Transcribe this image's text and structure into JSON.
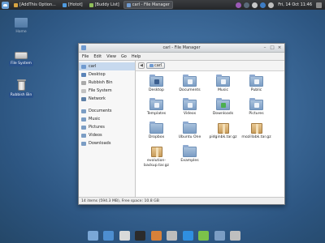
{
  "panel": {
    "tasks": [
      {
        "label": "[AddThis Option...",
        "color": "#d9a441",
        "active": false
      },
      {
        "label": "[Hotot]",
        "color": "#4f9be0",
        "active": false
      },
      {
        "label": "[Buddy List]",
        "color": "#8fbf5a",
        "active": false
      },
      {
        "label": "carl - File Manager",
        "color": "#6f9ad0",
        "active": true
      }
    ],
    "clock": "Fri, 14 Oct  11:46",
    "tray_colors": [
      "#9b59b6",
      "#5a6a7a",
      "#c7c7c7",
      "#3d7cc4",
      "#bdbdbd"
    ]
  },
  "desktop": {
    "home_label": "Home",
    "filesystem_label": "File System",
    "trash_label": "Rubbish Bin"
  },
  "window": {
    "title": "carl - File Manager",
    "menu": [
      "File",
      "Edit",
      "View",
      "Go",
      "Help"
    ],
    "sidebar": [
      {
        "label": "carl",
        "icon": "home-icon",
        "color": "#6f9ad0",
        "selected": true
      },
      {
        "label": "Desktop",
        "icon": "desktop-icon",
        "color": "#5b84b8"
      },
      {
        "label": "Rubbish Bin",
        "icon": "trash-icon",
        "color": "#a9a9a9"
      },
      {
        "label": "File System",
        "icon": "drive-icon",
        "color": "#c2c2c2"
      },
      {
        "label": "Network",
        "icon": "network-icon",
        "color": "#5d7fa6"
      },
      {
        "label": "Documents",
        "icon": "folder-icon",
        "color": "#7b9dc4"
      },
      {
        "label": "Music",
        "icon": "folder-icon",
        "color": "#7b9dc4"
      },
      {
        "label": "Pictures",
        "icon": "folder-icon",
        "color": "#7b9dc4"
      },
      {
        "label": "Videos",
        "icon": "folder-icon",
        "color": "#7b9dc4"
      },
      {
        "label": "Downloads",
        "icon": "folder-icon",
        "color": "#7b9dc4"
      }
    ],
    "path_button": "carl",
    "files": [
      {
        "label": "Desktop",
        "kind": "folder",
        "emblem": "#3c5f8f"
      },
      {
        "label": "Documents",
        "kind": "folder",
        "emblem": "#eef3f9"
      },
      {
        "label": "Music",
        "kind": "folder",
        "emblem": "#eef3f9"
      },
      {
        "label": "Public",
        "kind": "folder",
        "emblem": "#eef3f9"
      },
      {
        "label": "Templates",
        "kind": "folder",
        "emblem": "#eef3f9"
      },
      {
        "label": "Videos",
        "kind": "folder",
        "emblem": "#eef3f9"
      },
      {
        "label": "Downloads",
        "kind": "folder",
        "emblem": "#4caf50"
      },
      {
        "label": "Pictures",
        "kind": "folder",
        "emblem": "#eef3f9"
      },
      {
        "label": "Dropbox",
        "kind": "folder",
        "emblem": ""
      },
      {
        "label": "Ubuntu One",
        "kind": "folder",
        "emblem": ""
      },
      {
        "label": "pidginbk.tar.gz",
        "kind": "archive",
        "emblem": ""
      },
      {
        "label": "mozillabk.tar.gz",
        "kind": "archive",
        "emblem": ""
      },
      {
        "label": "evolution-\nbackup.tar.gz",
        "kind": "archive",
        "emblem": ""
      },
      {
        "label": "Examples",
        "kind": "folder",
        "emblem": ""
      }
    ],
    "status": "14 items (594.3 MB), Free space: 10.8 GB"
  },
  "dock": [
    {
      "name": "show-desktop",
      "color": "#7aa7d6"
    },
    {
      "name": "social-client",
      "color": "#4d8ed0"
    },
    {
      "name": "mail-client",
      "color": "#d9d9d9"
    },
    {
      "name": "terminal",
      "color": "#2b2b2b"
    },
    {
      "name": "browser",
      "color": "#d8813a"
    },
    {
      "name": "search",
      "color": "#bcbcbc"
    },
    {
      "name": "downloader",
      "color": "#2f8fe0"
    },
    {
      "name": "music-player",
      "color": "#7cc24a"
    },
    {
      "name": "file-manager",
      "color": "#7b9dc4"
    },
    {
      "name": "trash",
      "color": "#bfbfbf"
    }
  ]
}
